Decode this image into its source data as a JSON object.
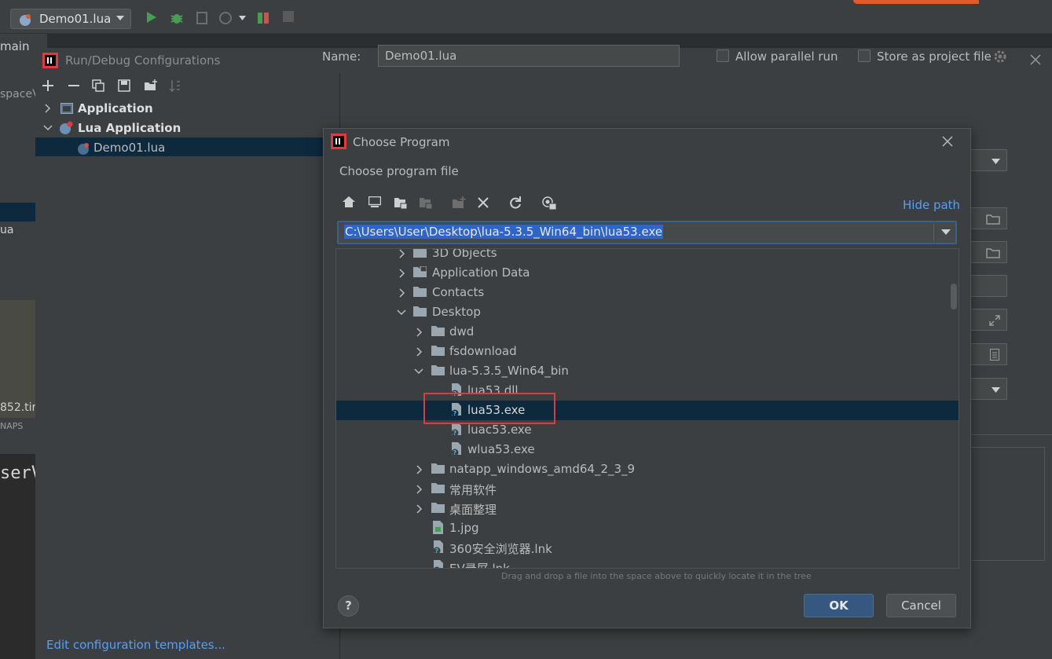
{
  "toolbar": {
    "run_config": "Demo01.lua"
  },
  "breadcrumb": {
    "main": "main"
  },
  "left_strip": {
    "space": "spaceV",
    "ua": "ua",
    "tif": "852.tir",
    "naps": "NAPS",
    "serv": "serV"
  },
  "rdc": {
    "title": "Run/Debug Configurations",
    "tree": {
      "application": "Application",
      "lua_application": "Lua Application",
      "demo": "Demo01.lua"
    },
    "name_label": "Name:",
    "name_value": "Demo01.lua",
    "allow_parallel": "Allow parallel run",
    "store_project": "Store as project file",
    "edit_templates": "Edit configuration templates..."
  },
  "choose": {
    "title": "Choose Program",
    "description": "Choose program file",
    "hide_path": "Hide path",
    "path": "C:\\Users\\User\\Desktop\\lua-5.3.5_Win64_bin\\lua53.exe",
    "tree": [
      {
        "label": "3D Objects"
      },
      {
        "label": "Application Data"
      },
      {
        "label": "Contacts"
      },
      {
        "label": "Desktop"
      },
      {
        "label": "dwd"
      },
      {
        "label": "fsdownload"
      },
      {
        "label": "lua-5.3.5_Win64_bin"
      },
      {
        "label": "lua53.dll"
      },
      {
        "label": "lua53.exe"
      },
      {
        "label": "luac53.exe"
      },
      {
        "label": "wlua53.exe"
      },
      {
        "label": "natapp_windows_amd64_2_3_9"
      },
      {
        "label": "常用软件"
      },
      {
        "label": "桌面整理"
      },
      {
        "label": "1.jpg"
      },
      {
        "label": "360安全浏览器.lnk"
      },
      {
        "label": "EV录屏.lnk"
      }
    ],
    "drag_hint": "Drag and drop a file into the space above to quickly locate it in the tree",
    "help": "?",
    "ok": "OK",
    "cancel": "Cancel"
  },
  "colors": {
    "accent": "#589df6",
    "selection": "#0d293e",
    "highlight": "#e0393e",
    "ok_button": "#365880"
  }
}
